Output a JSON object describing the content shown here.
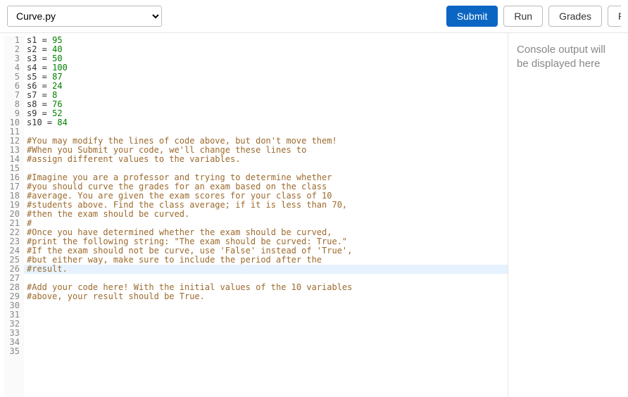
{
  "toolbar": {
    "file_selected": "Curve.py",
    "submit_label": "Submit",
    "run_label": "Run",
    "grades_label": "Grades",
    "reset_label": "R"
  },
  "console": {
    "placeholder": "Console output will be displayed here"
  },
  "editor": {
    "highlighted_line": 26,
    "lines": [
      {
        "t": "assign",
        "var": "s1",
        "op": " = ",
        "num": "95"
      },
      {
        "t": "assign",
        "var": "s2",
        "op": " = ",
        "num": "40"
      },
      {
        "t": "assign",
        "var": "s3",
        "op": " = ",
        "num": "50"
      },
      {
        "t": "assign",
        "var": "s4",
        "op": " = ",
        "num": "100"
      },
      {
        "t": "assign",
        "var": "s5",
        "op": " = ",
        "num": "87"
      },
      {
        "t": "assign",
        "var": "s6",
        "op": " = ",
        "num": "24"
      },
      {
        "t": "assign",
        "var": "s7",
        "op": " = ",
        "num": "8"
      },
      {
        "t": "assign",
        "var": "s8",
        "op": " = ",
        "num": "76"
      },
      {
        "t": "assign",
        "var": "s9",
        "op": " = ",
        "num": "52"
      },
      {
        "t": "assign",
        "var": "s10",
        "op": " = ",
        "num": "84"
      },
      {
        "t": "blank"
      },
      {
        "t": "comment",
        "text": "#You may modify the lines of code above, but don't move them!"
      },
      {
        "t": "comment",
        "text": "#When you Submit your code, we'll change these lines to"
      },
      {
        "t": "comment",
        "text": "#assign different values to the variables."
      },
      {
        "t": "blank"
      },
      {
        "t": "comment",
        "text": "#Imagine you are a professor and trying to determine whether"
      },
      {
        "t": "comment",
        "text": "#you should curve the grades for an exam based on the class"
      },
      {
        "t": "comment",
        "text": "#average. You are given the exam scores for your class of 10"
      },
      {
        "t": "comment",
        "text": "#students above. Find the class average; if it is less than 70,"
      },
      {
        "t": "comment",
        "text": "#then the exam should be curved."
      },
      {
        "t": "comment",
        "text": "#"
      },
      {
        "t": "comment",
        "text": "#Once you have determined whether the exam should be curved,"
      },
      {
        "t": "comment",
        "text": "#print the following string: \"The exam should be curved: True.\""
      },
      {
        "t": "comment",
        "text": "#If the exam should not be curve, use 'False' instead of 'True',"
      },
      {
        "t": "comment",
        "text": "#but either way, make sure to include the period after the"
      },
      {
        "t": "comment",
        "text": "#result."
      },
      {
        "t": "blank"
      },
      {
        "t": "comment",
        "text": "#Add your code here! With the initial values of the 10 variables"
      },
      {
        "t": "comment",
        "text": "#above, your result should be True."
      },
      {
        "t": "blank"
      },
      {
        "t": "blank"
      },
      {
        "t": "blank"
      },
      {
        "t": "blank"
      },
      {
        "t": "blank"
      },
      {
        "t": "blank"
      }
    ]
  }
}
